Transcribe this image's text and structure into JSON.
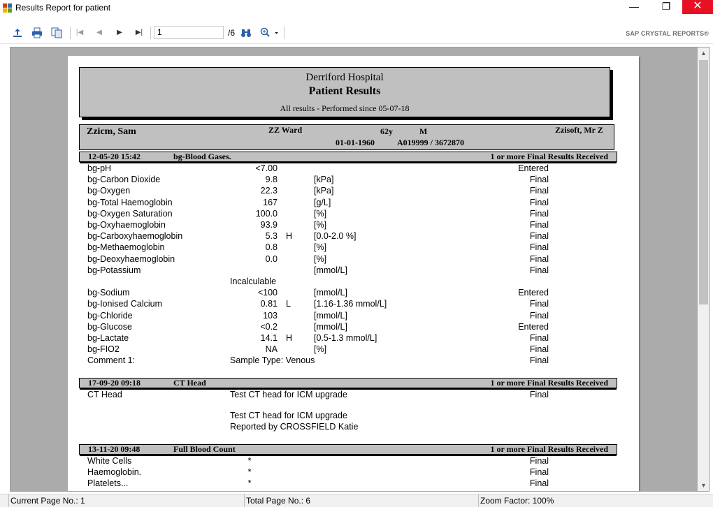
{
  "window": {
    "title": "Results Report for patient",
    "minimize_glyph": "—",
    "restore_glyph": "❐",
    "close_glyph": "✕"
  },
  "toolbar": {
    "export_icon": "export-icon",
    "print_icon": "print-icon",
    "copy_icon": "copy-icon",
    "first_icon": "first-page-icon",
    "prev_icon": "previous-page-icon",
    "next_icon": "next-page-icon",
    "last_icon": "last-page-icon",
    "current_page": "1",
    "page_total": "/6",
    "find_icon": "binoculars-icon",
    "zoom_icon": "zoom-icon",
    "brand": "SAP CRYSTAL REPORTS®"
  },
  "report": {
    "header": {
      "hospital": "Derriford Hospital",
      "title": "Patient Results",
      "subtitle": "All results - Performed since 05-07-18"
    },
    "patient": {
      "name": "Zzicm, Sam",
      "ward": "ZZ Ward",
      "age": "62y",
      "sex": "M",
      "consultant": "Zzisoft, Mr Z",
      "dob": "01-01-1960",
      "ids": "A019999 / 3672870"
    },
    "sections": [
      {
        "datetime": "12-05-20 15:42",
        "test": "bg-Blood Gases.",
        "status": "1 or more Final Results Received",
        "rows": [
          {
            "name": "bg-pH",
            "value": "<7.00",
            "flag": "",
            "range": "",
            "status": "Entered"
          },
          {
            "name": "bg-Carbon Dioxide",
            "value": "9.8",
            "flag": "",
            "range": "[kPa]",
            "status": "Final"
          },
          {
            "name": "bg-Oxygen",
            "value": "22.3",
            "flag": "",
            "range": "[kPa]",
            "status": "Final"
          },
          {
            "name": "bg-Total Haemoglobin",
            "value": "167",
            "flag": "",
            "range": "[g/L]",
            "status": "Final"
          },
          {
            "name": "bg-Oxygen Saturation",
            "value": "100.0",
            "flag": "",
            "range": "[%]",
            "status": "Final"
          },
          {
            "name": "bg-Oxyhaemoglobin",
            "value": "93.9",
            "flag": "",
            "range": "[%]",
            "status": "Final"
          },
          {
            "name": "bg-Carboxyhaemoglobin",
            "value": "5.3",
            "flag": "H",
            "range": "[0.0-2.0 %]",
            "status": "Final"
          },
          {
            "name": "bg-Methaemoglobin",
            "value": "0.8",
            "flag": "",
            "range": "[%]",
            "status": "Final"
          },
          {
            "name": "bg-Deoxyhaemoglobin",
            "value": "0.0",
            "flag": "",
            "range": "[%]",
            "status": "Final"
          },
          {
            "name": "bg-Potassium",
            "value": "",
            "flag": "",
            "range": "[mmol/L]",
            "status": "Final"
          },
          {
            "name": "",
            "value": "Incalculable",
            "flag": "",
            "range": "",
            "status": ""
          },
          {
            "name": "bg-Sodium",
            "value": "<100",
            "flag": "",
            "range": "[mmol/L]",
            "status": "Entered"
          },
          {
            "name": "bg-Ionised Calcium",
            "value": "0.81",
            "flag": "L",
            "range": "[1.16-1.36 mmol/L]",
            "status": "Final"
          },
          {
            "name": "bg-Chloride",
            "value": "103",
            "flag": "",
            "range": "[mmol/L]",
            "status": "Final"
          },
          {
            "name": "bg-Glucose",
            "value": "<0.2",
            "flag": "",
            "range": "[mmol/L]",
            "status": "Entered"
          },
          {
            "name": "bg-Lactate",
            "value": "14.1",
            "flag": "H",
            "range": "[0.5-1.3 mmol/L]",
            "status": "Final"
          },
          {
            "name": "bg-FIO2",
            "value": "NA",
            "flag": "",
            "range": "[%]",
            "status": "Final"
          },
          {
            "name": "Comment 1:",
            "value": "Sample Type: Venous",
            "flag": "",
            "range": "",
            "status": "Final"
          }
        ]
      },
      {
        "datetime": "17-09-20 09:18",
        "test": "CT Head",
        "status": "1 or more Final Results Received",
        "rows": [
          {
            "name": "CT Head",
            "text": "Test CT head for ICM upgrade",
            "status": "Final"
          },
          {
            "name": "",
            "text": "Test CT head for ICM upgrade",
            "status": ""
          },
          {
            "name": "",
            "text": "Reported by CROSSFIELD Katie",
            "status": ""
          }
        ]
      },
      {
        "datetime": "13-11-20 09:48",
        "test": "Full Blood Count",
        "status": "1 or more Final Results Received",
        "rows": [
          {
            "name": "White Cells",
            "value": "*",
            "status": "Final"
          },
          {
            "name": "Haemoglobin.",
            "value": "*",
            "status": "Final"
          },
          {
            "name": "Platelets...",
            "value": "*",
            "status": "Final"
          }
        ]
      }
    ]
  },
  "statusbar": {
    "current_page": "Current Page No.: 1",
    "total_pages": "Total Page No.: 6",
    "zoom": "Zoom Factor: 100%"
  },
  "colors": {
    "close_button": "#e81123",
    "report_band": "#c0c0c0",
    "viewer_bg": "#ababab",
    "toolbar_icon": "#2c5fa8"
  }
}
